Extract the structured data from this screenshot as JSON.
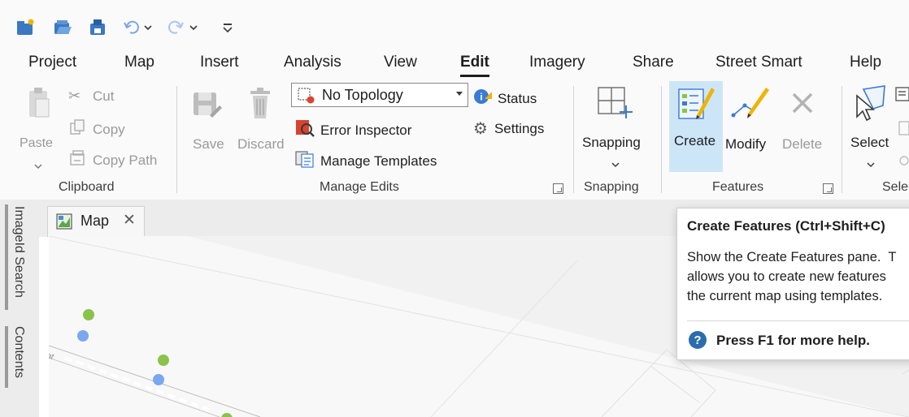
{
  "quick_access": {
    "icons": [
      "new-project-icon",
      "open-project-icon",
      "save-project-icon",
      "undo-icon",
      "redo-icon",
      "customize-icon"
    ]
  },
  "menu": {
    "items": [
      "Project",
      "Map",
      "Insert",
      "Analysis",
      "View",
      "Edit",
      "Imagery",
      "Share",
      "Street Smart",
      "Help"
    ],
    "active": "Edit"
  },
  "clipboard": {
    "paste": "Paste",
    "cut": "Cut",
    "copy": "Copy",
    "copy_path": "Copy Path",
    "group": "Clipboard"
  },
  "manage_edits": {
    "save": "Save",
    "discard": "Discard",
    "topology_value": "No Topology",
    "status": "Status",
    "error_inspector": "Error Inspector",
    "settings": "Settings",
    "manage_templates": "Manage Templates",
    "group": "Manage Edits"
  },
  "snapping": {
    "button": "Snapping",
    "group": "Snapping"
  },
  "features": {
    "create": "Create",
    "modify": "Modify",
    "delete": "Delete",
    "group": "Features"
  },
  "selection": {
    "select": "Select",
    "group_partial": "Sele"
  },
  "side_tabs": [
    "ImageId Search",
    "Contents"
  ],
  "map_tab": {
    "title": "Map",
    "close": "✕"
  },
  "map": {
    "road_label": "nat"
  },
  "tooltip": {
    "title": "Create Features (Ctrl+Shift+C)",
    "body": "Show the Create Features pane.  T\nallows you to create new features\nthe current map using templates.",
    "help": "Press F1 for more help."
  },
  "colors": {
    "accent_blue": "#2b6cb0",
    "create_highlight": "#cde6f7",
    "point_green": "#8bc34a",
    "point_blue": "#7aa7f0"
  }
}
